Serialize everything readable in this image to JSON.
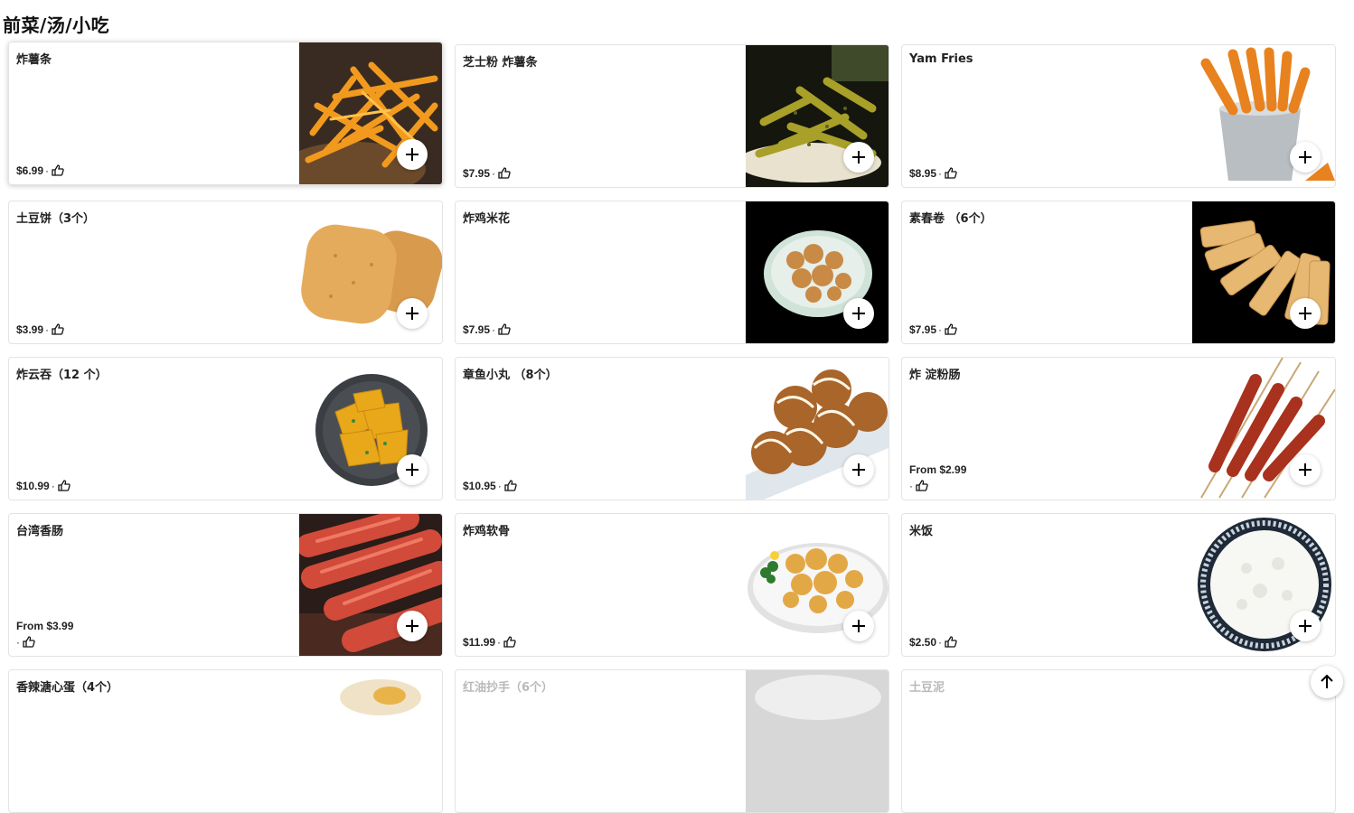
{
  "section": {
    "title": "前菜/汤/小吃"
  },
  "items": [
    {
      "name": "炸薯条",
      "price": "$6.99",
      "icon": "fries-photo"
    },
    {
      "name": "芝士粉 炸薯条",
      "price": "$7.95",
      "icon": "cheese-fries-photo"
    },
    {
      "name": "Yam Fries",
      "price": "$8.95",
      "icon": "yam-fries-photo"
    },
    {
      "name": "土豆饼（3个）",
      "price": "$3.99",
      "icon": "hash-brown-photo"
    },
    {
      "name": "炸鸡米花",
      "price": "$7.95",
      "icon": "popcorn-chicken-photo"
    },
    {
      "name": "素春卷 （6个）",
      "price": "$7.95",
      "icon": "spring-roll-photo"
    },
    {
      "name": "炸云吞（12 个）",
      "price": "$10.99",
      "icon": "wonton-photo"
    },
    {
      "name": "章鱼小丸 （8个）",
      "price": "$10.95",
      "icon": "takoyaki-photo"
    },
    {
      "name": "炸 淀粉肠",
      "price": "From $2.99",
      "icon": "starch-sausage-photo"
    },
    {
      "name": "台湾香肠",
      "price": "From $3.99",
      "icon": "taiwan-sausage-photo"
    },
    {
      "name": "炸鸡软骨",
      "price": "$11.99",
      "icon": "chicken-cartilage-photo"
    },
    {
      "name": "米饭",
      "price": "$2.50",
      "icon": "rice-photo"
    },
    {
      "name": "香辣溏心蛋（4个）",
      "price": "",
      "icon": "egg-photo"
    },
    {
      "name": "红油抄手（6个）",
      "price": "",
      "icon": "chili-wonton-photo"
    },
    {
      "name": "土豆泥",
      "price": "",
      "icon": "mashed-potato-photo"
    }
  ],
  "icons": {
    "add": "plus-icon",
    "like": "thumbs-up-icon",
    "scroll_top": "arrow-up-icon"
  },
  "colors": {
    "accent": "#000000",
    "card_border": "#e3e3e3",
    "faded_text": "#b9b9b9"
  }
}
